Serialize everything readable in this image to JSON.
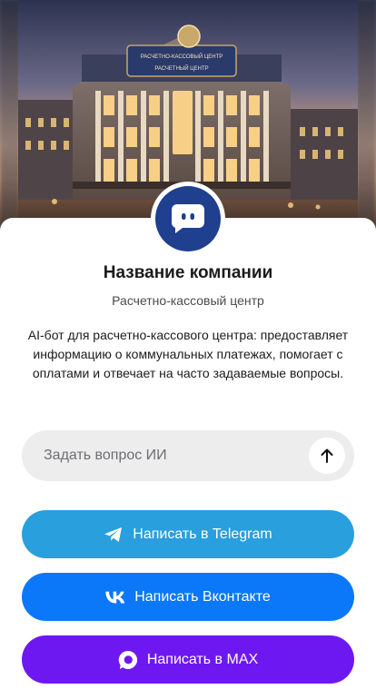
{
  "company": {
    "name": "Название компании",
    "category": "Расчетно-кассовый центр",
    "description": "AI-бот для расчетно-кассового центра: предоставляет информацию о коммунальных платежах, помогает с оплатами и отвечает на часто задаваемые вопросы."
  },
  "hero": {
    "sign_top": "РАСЧЕТНО-КАССОВЫЙ ЦЕНТР",
    "sign_bottom": "РАСЧЕТНЫЙ ЦЕНТР"
  },
  "ask": {
    "placeholder": "Задать вопрос ИИ",
    "send_icon": "arrow-up-icon"
  },
  "actions": {
    "telegram": {
      "label": "Написать в Telegram",
      "icon": "telegram-icon",
      "color": "#2a9fde"
    },
    "vk": {
      "label": "Написать Вконтакте",
      "icon": "vk-icon",
      "color": "#0a78f8"
    },
    "max": {
      "label": "Написать в MAX",
      "icon": "max-icon",
      "color": "#6e18f1"
    }
  },
  "colors": {
    "avatar_bg": "#1f3f8f",
    "input_bg": "#ededee"
  }
}
